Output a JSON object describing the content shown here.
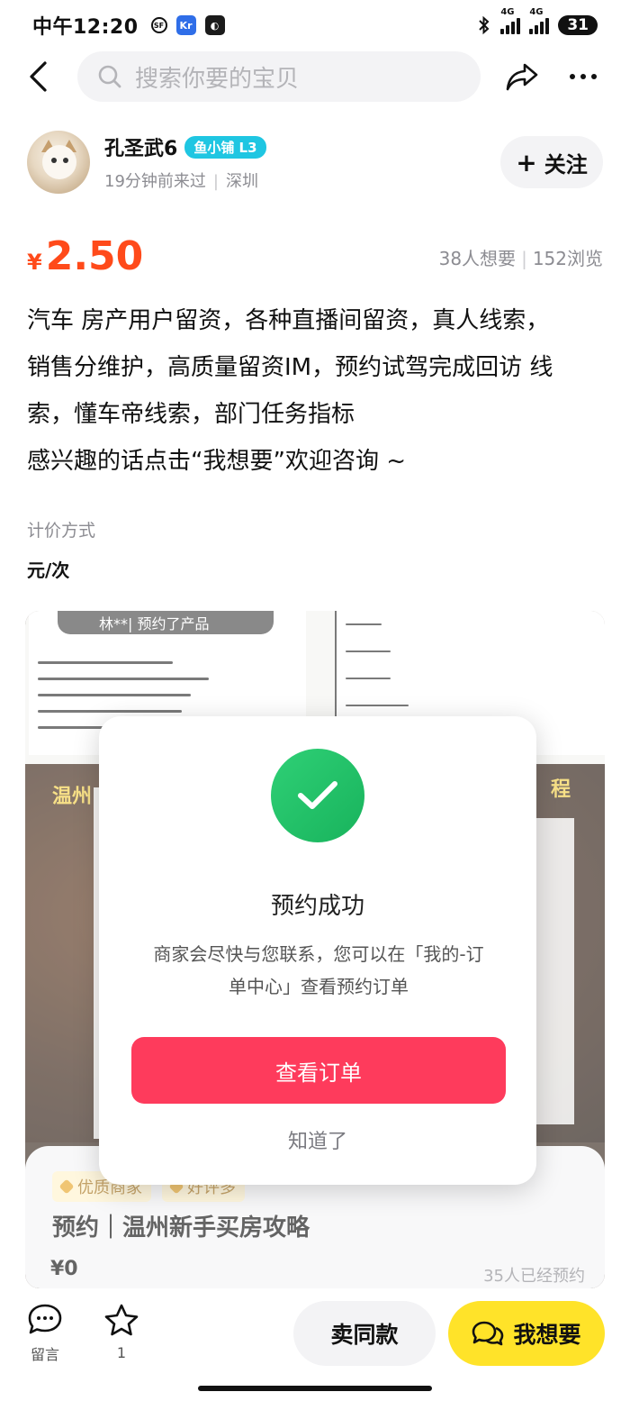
{
  "status_bar": {
    "time": "中午12:20",
    "battery": "31",
    "network_1": "4G",
    "network_2": "4G"
  },
  "nav": {
    "search_placeholder": "搜索你要的宝贝"
  },
  "seller": {
    "name": "孔圣武6",
    "level": "鱼小铺 L3",
    "last_visit": "19分钟前来过",
    "location": "深圳",
    "follow_label": "关注"
  },
  "product": {
    "currency": "¥",
    "price": "2.50",
    "wants": "38人想要",
    "views": "152浏览",
    "description_lines": [
      "汽车 房产用户留资，各种直播间留资，真人线索，",
      "销售分维护，高质量留资IM，预约试驾完成回访 线",
      "索，懂车帝线索，部门任务指标",
      "感兴趣的话点击“我想要”欢迎咨询 ~"
    ],
    "pricing_label": "计价方式",
    "pricing_value": "元/次"
  },
  "image_card": {
    "toast": "林**| 预约了产品",
    "heading": "温州",
    "heading_right": "程",
    "tags": [
      "优质商家",
      "好评多"
    ],
    "title": "预约｜温州新手买房攻略",
    "price": "¥0",
    "booked": "35人已经预约"
  },
  "modal": {
    "title": "预约成功",
    "message": "商家会尽快与您联系，您可以在「我的-订单中心」查看预约订单",
    "primary_label": "查看订单",
    "secondary_label": "知道了"
  },
  "bottom_bar": {
    "comment_label": "留言",
    "favorite_count": "1",
    "sell_label": "卖同款",
    "want_label": "我想要"
  },
  "colors": {
    "price": "#ff4a1a",
    "primary_button": "#fe3b5c",
    "want_button": "#ffe329",
    "success": "#18b35c",
    "level_badge": "#1fc6e2"
  }
}
